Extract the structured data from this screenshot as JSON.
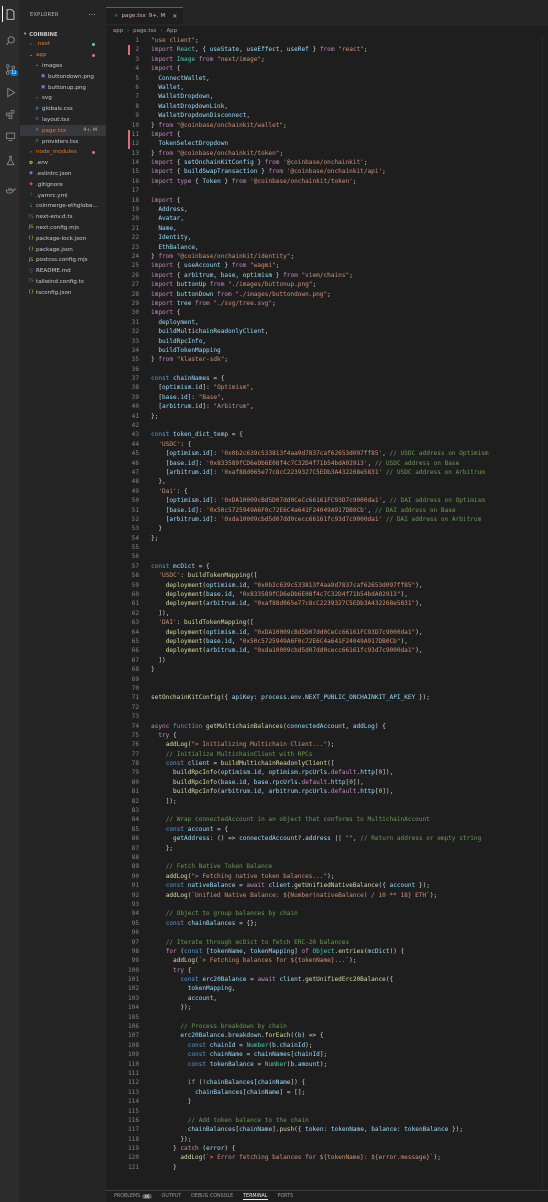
{
  "activity": [
    {
      "name": "explorer-icon",
      "glyph": "files"
    },
    {
      "name": "search-icon",
      "glyph": "search"
    },
    {
      "name": "source-control-icon",
      "glyph": "git"
    },
    {
      "name": "run-debug-icon",
      "glyph": "run"
    },
    {
      "name": "extensions-icon",
      "glyph": "ext"
    },
    {
      "name": "remote-explorer-icon",
      "glyph": "remote"
    },
    {
      "name": "testing-icon",
      "glyph": "test"
    },
    {
      "name": "docker-icon",
      "glyph": "docker"
    }
  ],
  "scm_badge": "12",
  "explorer": {
    "title": "EXPLORER",
    "more": "···",
    "project": "COINBINE",
    "items": [
      {
        "label": ".next",
        "indent": 1,
        "type": "folder-closed",
        "color": "#e37933",
        "dot": "#73c991"
      },
      {
        "label": "app",
        "indent": 1,
        "type": "folder-open",
        "color": "#e37933",
        "dot": "#e06c75"
      },
      {
        "label": "images",
        "indent": 2,
        "type": "folder-open",
        "color": "#cccccc"
      },
      {
        "label": "buttondown.png",
        "indent": 3,
        "type": "image",
        "color": "#cccccc"
      },
      {
        "label": "buttonup.png",
        "indent": 3,
        "type": "image",
        "color": "#cccccc"
      },
      {
        "label": "svg",
        "indent": 2,
        "type": "folder-closed",
        "color": "#cccccc"
      },
      {
        "label": "globals.css",
        "indent": 2,
        "type": "css",
        "color": "#cccccc"
      },
      {
        "label": "layout.tsx",
        "indent": 2,
        "type": "tsx",
        "color": "#cccccc"
      },
      {
        "label": "page.tsx",
        "indent": 2,
        "type": "tsx",
        "color": "#e37933",
        "status": "9+, M",
        "selected": true
      },
      {
        "label": "providers.tsx",
        "indent": 2,
        "type": "tsx",
        "color": "#cccccc"
      },
      {
        "label": "node_modules",
        "indent": 1,
        "type": "folder-closed",
        "color": "#e37933",
        "dot": "#e06c75"
      },
      {
        "label": ".env",
        "indent": 1,
        "type": "env",
        "color": "#cccccc"
      },
      {
        "label": ".eslintrc.json",
        "indent": 1,
        "type": "eslint",
        "color": "#cccccc"
      },
      {
        "label": ".gitignore",
        "indent": 1,
        "type": "git",
        "color": "#cccccc"
      },
      {
        "label": ".yarnrc.yml",
        "indent": 1,
        "type": "yarn",
        "color": "#cccccc"
      },
      {
        "label": "coinmerge-ethgloba...",
        "indent": 1,
        "type": "md",
        "color": "#cccccc"
      },
      {
        "label": "next-env.d.ts",
        "indent": 1,
        "type": "ts",
        "color": "#cccccc"
      },
      {
        "label": "next.config.mjs",
        "indent": 1,
        "type": "js",
        "color": "#cccccc"
      },
      {
        "label": "package-lock.json",
        "indent": 1,
        "type": "json",
        "color": "#cccccc"
      },
      {
        "label": "package.json",
        "indent": 1,
        "type": "json",
        "color": "#cccccc"
      },
      {
        "label": "postcss.config.mjs",
        "indent": 1,
        "type": "js",
        "color": "#cccccc"
      },
      {
        "label": "README.md",
        "indent": 1,
        "type": "info",
        "color": "#cccccc"
      },
      {
        "label": "tailwind.config.ts",
        "indent": 1,
        "type": "ts",
        "color": "#cccccc"
      },
      {
        "label": "tsconfig.json",
        "indent": 1,
        "type": "json",
        "color": "#cccccc"
      }
    ]
  },
  "tab": {
    "label": "page.tsx",
    "status": "9+, M",
    "close": "×",
    "icon": "TSX"
  },
  "breadcrumb": {
    "parts": [
      "app",
      "page.tsx",
      "App"
    ],
    "sep": "›"
  },
  "code_lines": [
    "\"use client\";",
    "import React, { useState, useEffect, useRef } from \"react\";",
    "import Image from \"next/image\";",
    "import {",
    "  ConnectWallet,",
    "  Wallet,",
    "  WalletDropdown,",
    "  WalletDropdownLink,",
    "  WalletDropdownDisconnect,",
    "} from \"@coinbase/onchainkit/wallet\";",
    "import {",
    "  TokenSelectDropdown",
    "} from \"@coinbase/onchainkit/token\";",
    "import { setOnchainKitConfig } from '@coinbase/onchainkit';",
    "import { buildSwapTransaction } from '@coinbase/onchainkit/api';",
    "import type { Token } from '@coinbase/onchainkit/token';",
    "",
    "import {",
    "  Address,",
    "  Avatar,",
    "  Name,",
    "  Identity,",
    "  EthBalance,",
    "} from \"@coinbase/onchainkit/identity\";",
    "import { useAccount } from \"wagmi\";",
    "import { arbitrum, base, optimism } from \"viem/chains\";",
    "import buttonUp from \"./images/buttonup.png\";",
    "import buttonDown from \"./images/buttondown.png\";",
    "import tree from \"./svg/tree.svg\";",
    "import {",
    "  deployment,",
    "  buildMultichainReadonlyClient,",
    "  buildRpcInfo,",
    "  buildTokenMapping",
    "} from \"klaster-sdk\";",
    "",
    "const chainNames = {",
    "  [optimism.id]: \"Optimism\",",
    "  [base.id]: \"Base\",",
    "  [arbitrum.id]: \"Arbitrum\",",
    "};",
    "",
    "const token_dict_temp = {",
    "  'USDC': {",
    "    [optimism.id]: '0x0b2c639c533813f4aa9d7837caf62653d097ff85', // USDC address on Optimism",
    "    [base.id]: '0x833589fCD6eDb6E08f4c7C32D4f71b54bdA02913', // USDC address on Base",
    "    [arbitrum.id]: '0xaf88d065e77c8cC2239327C5EDb3A432268e5831' // USDC address on Arbitrum",
    "  },",
    "  'Dai': {",
    "    [optimism.id]: '0xDA10009cBd5D07dd0CeCc66161FC93D7c9000da1', // DAI address on Optimism",
    "    [base.id]: '0x50c5725949A6F0c72E6C4a641F24049A917DB0Cb', // DAI address on Base",
    "    [arbitrum.id]: '0xda10009cbd5d07dd0cecc66161fc93d7c9000da1' // DAI address on Arbitrum",
    "  }",
    "};",
    "",
    "",
    "const mcDict = {",
    "  'USDC': buildTokenMapping([",
    "    deployment(optimism.id, \"0x0b2c639c533813f4aa9d7837caf62653d097ff85\"),",
    "    deployment(base.id, \"0x833589fCD6eDb6E08f4c7C32D4f71b54bdA02913\"),",
    "    deployment(arbitrum.id, \"0xaf88d065e77c8cC2239327C5EDb3A432268e5831\"),",
    "  ]),",
    "  'DAI': buildTokenMapping([",
    "    deployment(optimism.id, \"0xDA10009cBd5D07dd0CeCc66161FC93D7c9000da1\"),",
    "    deployment(base.id, \"0x50c5725949A6F0c72E6C4a641F24049A917DB0Cb\"),",
    "    deployment(arbitrum.id, \"0xda10009cbd5d07dd0cecc66161fc93d7c9000da1\"),",
    "  ])",
    "}",
    "",
    "",
    "setOnchainKitConfig({ apiKey: process.env.NEXT_PUBLIC_ONCHAINKIT_API_KEY });",
    "",
    "",
    "async function getMultichainBalances(connectedAccount, addLog) {",
    "  try {",
    "    addLog(\"> Initializing Multichain Client...\");",
    "    // Initialize MultichainClient with RPCs",
    "    const client = buildMultichainReadonlyClient([",
    "      buildRpcInfo(optimism.id, optimism.rpcUrls.default.http[0]),",
    "      buildRpcInfo(base.id, base.rpcUrls.default.http[0]),",
    "      buildRpcInfo(arbitrum.id, arbitrum.rpcUrls.default.http[0]),",
    "    ]);",
    "",
    "    // Wrap connectedAccount in an object that conforms to MultichainAccount",
    "    const account = {",
    "      getAddress: () => connectedAccount?.address || \"\", // Return address or empty string",
    "    };",
    "",
    "    // Fetch Native Token Balance",
    "    addLog(\"> Fetching native token balances...\");",
    "    const nativeBalance = await client.getUnifiedNativeBalance({ account });",
    "    addLog(`Unified Native Balance: ${Number(nativeBalance) / 10 ** 18} ETH`);",
    "",
    "    // Object to group balances by chain",
    "    const chainBalances = {};",
    "",
    "    // Iterate through mcDict to fetch ERC-20 balances",
    "    for (const [tokenName, tokenMapping] of Object.entries(mcDict)) {",
    "      addLog(`> Fetching balances for ${tokenName}...`);",
    "      try {",
    "        const erc20Balance = await client.getUnifiedErc20Balance({",
    "          tokenMapping,",
    "          account,",
    "        });",
    "",
    "        // Process breakdown by chain",
    "        erc20Balance.breakdown.forEach((b) => {",
    "          const chainId = Number(b.chainId);",
    "          const chainName = chainNames[chainId];",
    "          const tokenBalance = Number(b.amount);",
    "",
    "          if (!chainBalances[chainName]) {",
    "            chainBalances[chainName] = [];",
    "          }",
    "",
    "          // Add token balance to the chain",
    "          chainBalances[chainName].push({ token: tokenName, balance: tokenBalance });",
    "        });",
    "      } catch (error) {",
    "        addLog(`> Error fetching balances for ${tokenName}: ${error.message}`);",
    "      }"
  ],
  "gutter": {
    "modified_lines": [
      2,
      11,
      12
    ]
  },
  "panel_tabs": [
    {
      "label": "PROBLEMS",
      "count": "46"
    },
    {
      "label": "OUTPUT"
    },
    {
      "label": "DEBUG CONSOLE"
    },
    {
      "label": "TERMINAL",
      "active": true
    },
    {
      "label": "PORTS"
    }
  ],
  "colors": {
    "keyword": "#c586c0",
    "storage": "#569cd6",
    "string": "#ce9178",
    "comment": "#6a9955",
    "function": "#dcdcaa",
    "variable": "#9cdcfe",
    "number": "#b5cea8",
    "type": "#4ec9b0",
    "plain": "#d4d4d4"
  }
}
